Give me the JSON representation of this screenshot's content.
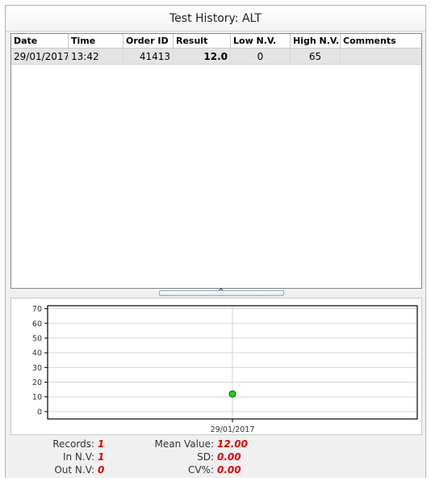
{
  "window": {
    "title": "Test History: ALT"
  },
  "table": {
    "columns": [
      "Date",
      "Time",
      "Order ID",
      "Result",
      "Low N.V.",
      "High N.V.",
      "Comments"
    ],
    "rows": [
      {
        "date": "29/01/2017",
        "time": "13:42",
        "order_id": "41413",
        "result": "12.0",
        "low_nv": "0",
        "high_nv": "65",
        "comments": ""
      }
    ]
  },
  "splitter": {
    "icon": "collapse-up-icon",
    "glyph": "^"
  },
  "chart_data": {
    "type": "scatter",
    "x": [
      "29/01/2017"
    ],
    "y": [
      12.0
    ],
    "ylim": [
      -5,
      72
    ],
    "yticks": [
      0,
      10,
      20,
      30,
      40,
      50,
      60,
      70
    ],
    "xticks": [
      "29/01/2017"
    ],
    "grid": true,
    "point_color": "#22cc22"
  },
  "stats": {
    "records_label": "Records:",
    "records_value": "1",
    "in_nv_label": "In N.V:",
    "in_nv_value": "1",
    "out_nv_label": "Out N.V:",
    "out_nv_value": "0",
    "mean_label": "Mean Value:",
    "mean_value": "12.00",
    "sd_label": "SD:",
    "sd_value": "0.00",
    "cv_label": "CV%:",
    "cv_value": "0.00"
  }
}
